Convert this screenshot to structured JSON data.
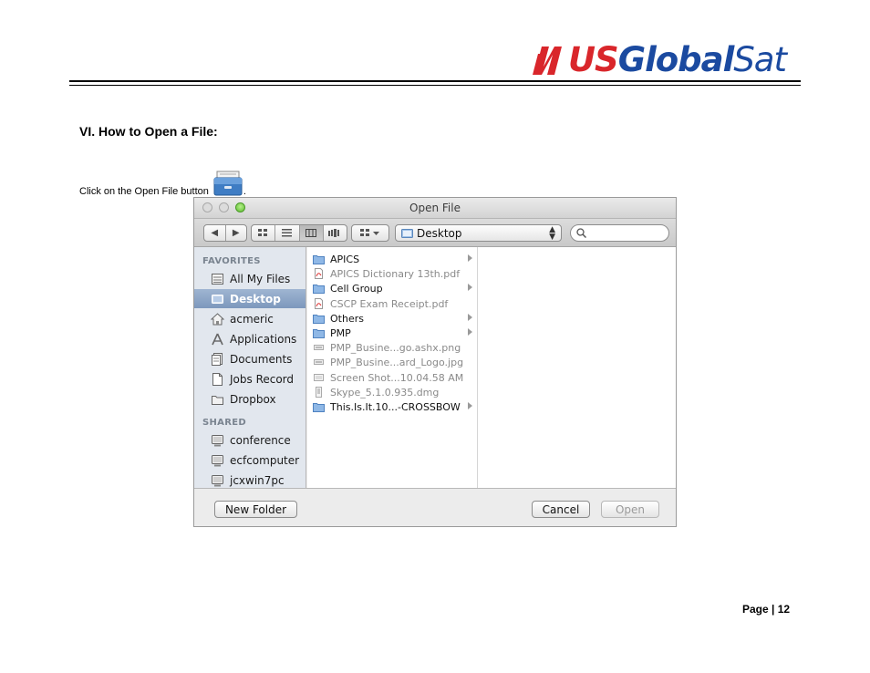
{
  "header": {
    "logo_us": "US",
    "logo_global": "Global",
    "logo_sat": "Sat",
    "brand_colors": {
      "red": "#d9262b",
      "blue": "#1b4aa0"
    }
  },
  "section": {
    "title": "VI. How to Open a File:",
    "instruction": "Click on the Open File button",
    "instruction_end": "."
  },
  "dialog": {
    "title": "Open File",
    "toolbar": {
      "back_icon": "◀",
      "forward_icon": "▶",
      "path_label": "Desktop",
      "search_value": "",
      "search_placeholder": ""
    },
    "sidebar": {
      "favorites_heading": "FAVORITES",
      "favorites": [
        {
          "label": "All My Files",
          "icon": "all-files-icon"
        },
        {
          "label": "Desktop",
          "icon": "desktop-icon"
        },
        {
          "label": "acmeric",
          "icon": "home-icon"
        },
        {
          "label": "Applications",
          "icon": "applications-icon"
        },
        {
          "label": "Documents",
          "icon": "documents-icon"
        },
        {
          "label": "Jobs Record",
          "icon": "document-icon"
        },
        {
          "label": "Dropbox",
          "icon": "folder-icon"
        }
      ],
      "shared_heading": "SHARED",
      "shared": [
        {
          "label": "conference",
          "icon": "computer-icon"
        },
        {
          "label": "ecfcomputer",
          "icon": "computer-icon"
        },
        {
          "label": "jcxwin7pc",
          "icon": "computer-icon"
        }
      ]
    },
    "files": [
      {
        "name": "APICS",
        "type": "folder"
      },
      {
        "name": "APICS Dictionary 13th.pdf",
        "type": "pdf"
      },
      {
        "name": "Cell Group",
        "type": "folder"
      },
      {
        "name": "CSCP Exam Receipt.pdf",
        "type": "pdf"
      },
      {
        "name": "Others",
        "type": "folder"
      },
      {
        "name": "PMP",
        "type": "folder"
      },
      {
        "name": "PMP_Busine...go.ashx.png",
        "type": "image"
      },
      {
        "name": "PMP_Busine...ard_Logo.jpg",
        "type": "image"
      },
      {
        "name": "Screen Shot...10.04.58 AM",
        "type": "image"
      },
      {
        "name": "Skype_5.1.0.935.dmg",
        "type": "disk-image"
      },
      {
        "name": "This.Is.It.10...-CROSSBOW",
        "type": "folder"
      }
    ],
    "buttons": {
      "new_folder": "New Folder",
      "cancel": "Cancel",
      "open": "Open"
    }
  },
  "footer": {
    "page_label": "Page | 12"
  }
}
